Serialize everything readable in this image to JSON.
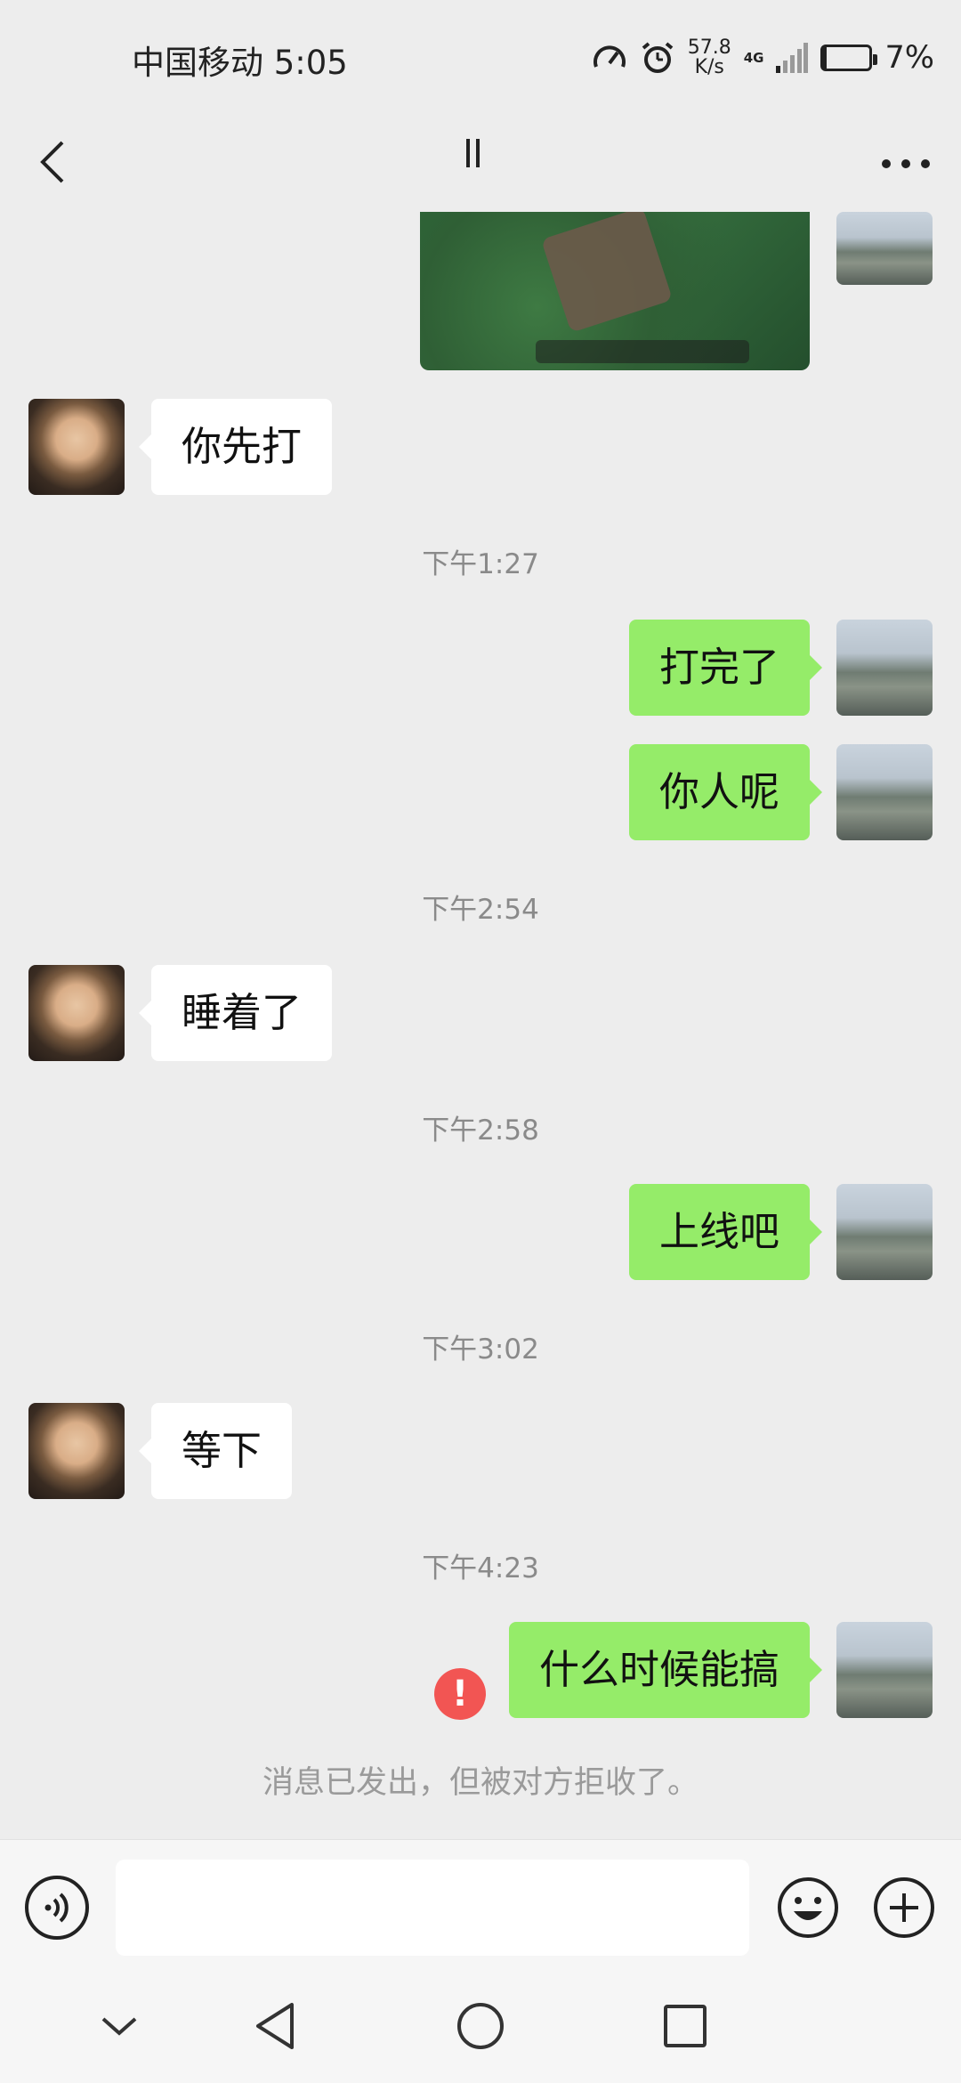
{
  "status_bar": {
    "carrier_time": "中国移动 5:05",
    "speed_value": "57.8",
    "speed_unit": "K/s",
    "network": "4G",
    "battery_percent": "7%",
    "battery_level": 0.07
  },
  "title_bar": {
    "back_icon": "chevron-left-icon",
    "more_icon": "more-horizontal-icon"
  },
  "messages": [
    {
      "kind": "image",
      "from": "me"
    },
    {
      "kind": "text",
      "from": "friend",
      "text": "你先打"
    },
    {
      "kind": "time",
      "text": "下午1:27"
    },
    {
      "kind": "text",
      "from": "me",
      "text": "打完了"
    },
    {
      "kind": "text",
      "from": "me",
      "text": "你人呢"
    },
    {
      "kind": "time",
      "text": "下午2:54"
    },
    {
      "kind": "text",
      "from": "friend",
      "text": "睡着了"
    },
    {
      "kind": "time",
      "text": "下午2:58"
    },
    {
      "kind": "text",
      "from": "me",
      "text": "上线吧"
    },
    {
      "kind": "time",
      "text": "下午3:02"
    },
    {
      "kind": "text",
      "from": "friend",
      "text": "等下"
    },
    {
      "kind": "time",
      "text": "下午4:23"
    },
    {
      "kind": "text",
      "from": "me",
      "text": "什么时候能搞",
      "status": "rejected",
      "status_icon": "exclamation-icon"
    },
    {
      "kind": "system",
      "text": "消息已发出，但被对方拒收了。"
    }
  ],
  "input_bar": {
    "voice_icon": "voice-icon",
    "input_value": "",
    "emoji_icon": "emoji-icon",
    "plus_icon": "plus-icon"
  },
  "system_nav": {
    "icons": [
      "chevron-down-icon",
      "back-triangle-icon",
      "home-circle-icon",
      "recents-square-icon"
    ]
  },
  "colors": {
    "background": "#ededed",
    "sent_bubble": "#95ec69",
    "received_bubble": "#ffffff",
    "error": "#f25553",
    "muted_text": "#8a8a8a"
  }
}
